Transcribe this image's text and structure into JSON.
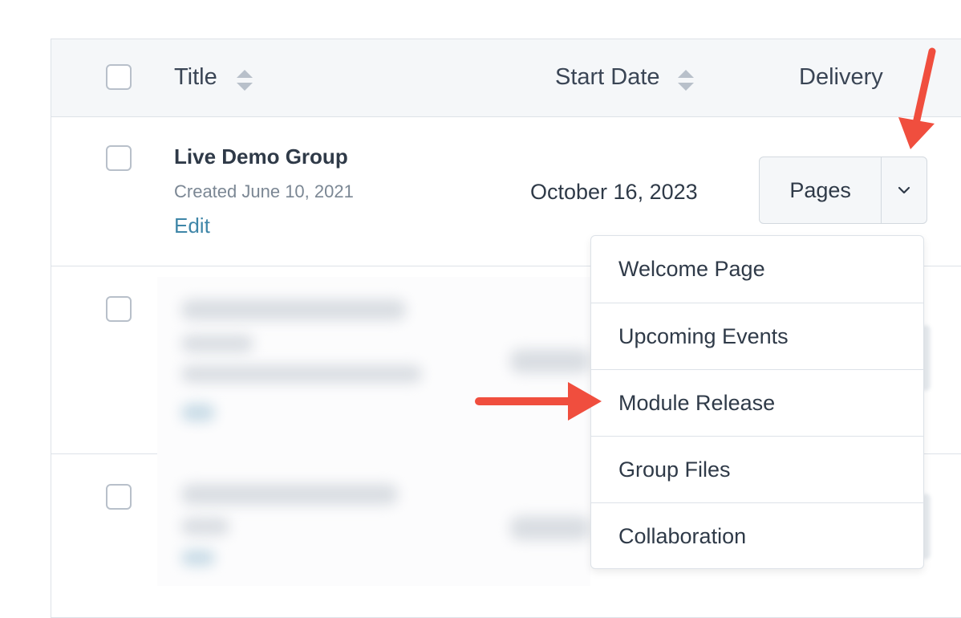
{
  "table": {
    "headers": {
      "title": "Title",
      "start_date": "Start Date",
      "delivery": "Delivery"
    },
    "rows": [
      {
        "title": "Live Demo Group",
        "created": "Created June 10, 2021",
        "edit_label": "Edit",
        "start_date": "October 16, 2023",
        "delivery_button": "Pages"
      }
    ]
  },
  "dropdown": {
    "items": [
      "Welcome Page",
      "Upcoming Events",
      "Module Release",
      "Group Files",
      "Collaboration"
    ]
  },
  "colors": {
    "annotation_arrow": "#f04e3e",
    "link": "#3f86a8",
    "header_bg": "#f5f7f9"
  },
  "icons": [
    "sort-icon",
    "chevron-down-icon",
    "annotation-arrow"
  ]
}
